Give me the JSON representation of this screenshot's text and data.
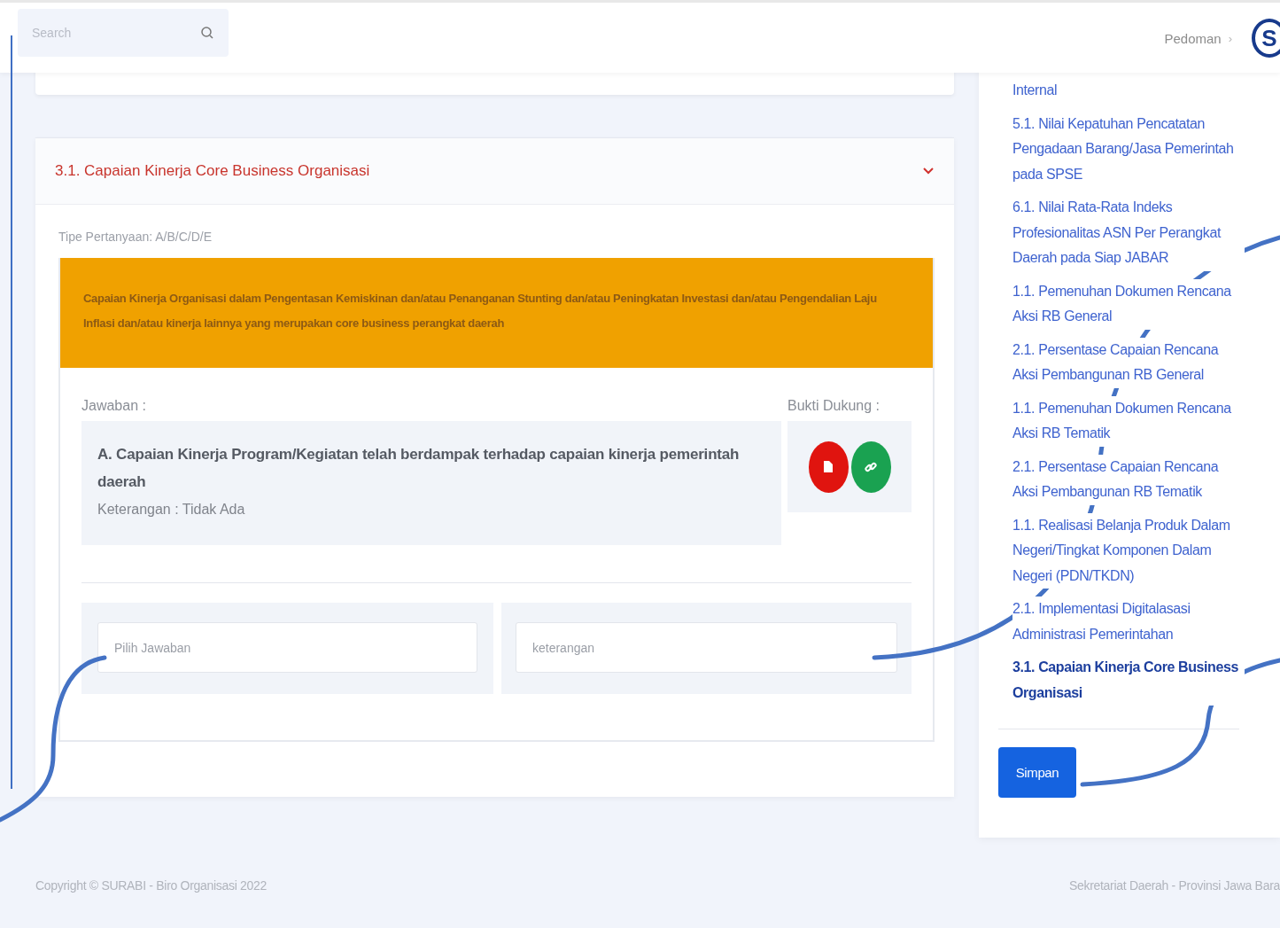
{
  "header": {
    "search": {
      "placeholder": "Search"
    },
    "breadcrumb": {
      "label": "Pedoman",
      "separator": "›"
    },
    "logo": {
      "text": "S"
    }
  },
  "question": {
    "title": "3.1. Capaian Kinerja Core Business Organisasi",
    "expanded": true,
    "type_label": "Tipe Pertanyaan: A/B/C/D/E",
    "text": "Capaian Kinerja Organisasi dalam Pengentasan Kemiskinan dan/atau Penanganan Stunting dan/atau Peningkatan Investasi dan/atau Pengendalian Laju Inflasi dan/atau kinerja lainnya yang merupakan core business perangkat daerah",
    "answer_label": "Jawaban :",
    "answer": "A. Capaian Kinerja Program/Kegiatan telah berdampak terhadap capaian kinerja pemerintah daerah",
    "note": "Keterangan : Tidak Ada",
    "evidence_label": "Bukti Dukung :",
    "evidence": [
      {
        "kind": "file",
        "color": "#e0140f"
      },
      {
        "kind": "link",
        "color": "#1aa251"
      }
    ],
    "answer_select": {
      "placeholder": "Pilih Jawaban"
    },
    "note_field": {
      "placeholder": "keterangan"
    }
  },
  "sidebar": {
    "items": [
      {
        "label": "Internal",
        "selected": false
      },
      {
        "label": "5.1. Nilai Kepatuhan Pencatatan Pengadaan Barang/Jasa Pemerintah pada SPSE",
        "selected": false
      },
      {
        "label": "6.1. Nilai Rata-Rata Indeks Profesionalitas ASN Per Perangkat Daerah pada Siap JABAR",
        "selected": false
      },
      {
        "label": "1.1. Pemenuhan Dokumen Rencana Aksi RB General",
        "selected": false
      },
      {
        "label": "2.1. Persentase Capaian Rencana Aksi Pembangunan RB General",
        "selected": false
      },
      {
        "label": "1.1. Pemenuhan Dokumen Rencana Aksi RB Tematik",
        "selected": false
      },
      {
        "label": "2.1. Persentase Capaian Rencana Aksi Pembangunan RB Tematik",
        "selected": false
      },
      {
        "label": "1.1. Realisasi Belanja Produk Dalam Negeri/Tingkat Komponen Dalam Negeri (PDN/TKDN)",
        "selected": false
      },
      {
        "label": "2.1. Implementasi Digitalasasi Administrasi Pemerintahan",
        "selected": false
      },
      {
        "label": "3.1. Capaian Kinerja Core Business Organisasi",
        "selected": true
      }
    ],
    "save_button": "Simpan"
  },
  "footer": {
    "left": "Copyright © SURABI - Biro Organisasi 2022",
    "right": "Sekretariat Daerah - Provinsi Jawa Bara"
  }
}
